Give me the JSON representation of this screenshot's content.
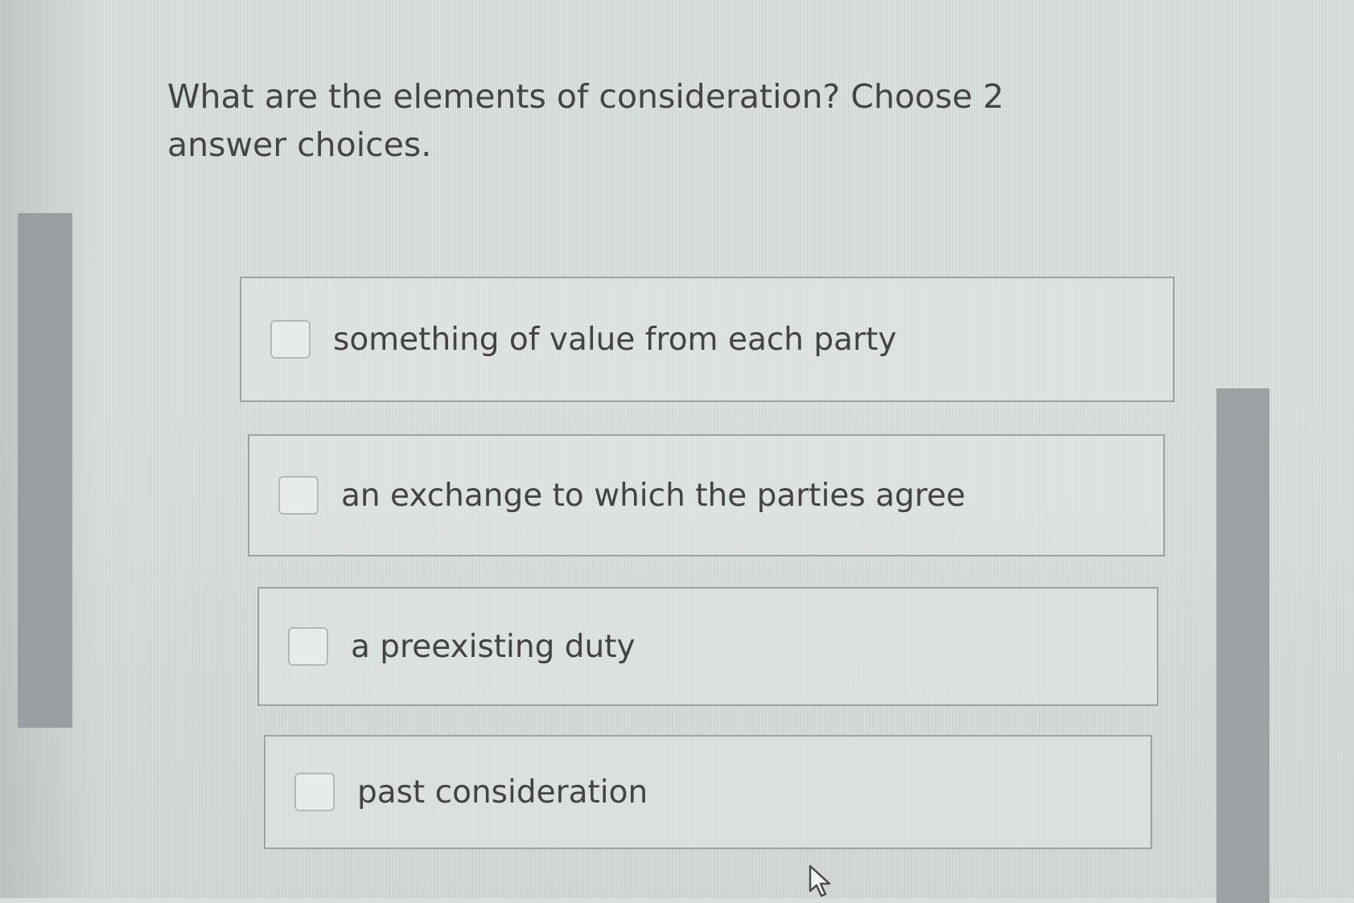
{
  "question": {
    "text": "What are the elements of consideration? Choose 2 answer choices."
  },
  "options": [
    {
      "label": "something of value from each party",
      "checked": false
    },
    {
      "label": "an exchange to which the parties agree",
      "checked": false
    },
    {
      "label": "a preexisting duty",
      "checked": false
    },
    {
      "label": "past consideration",
      "checked": false
    }
  ],
  "icons": {
    "cursor": "mouse-pointer-icon"
  },
  "colors": {
    "background": "#d8dfdc",
    "option_border": "#9da3a2",
    "text": "#444444",
    "side_bars": "#9a9ea0"
  }
}
